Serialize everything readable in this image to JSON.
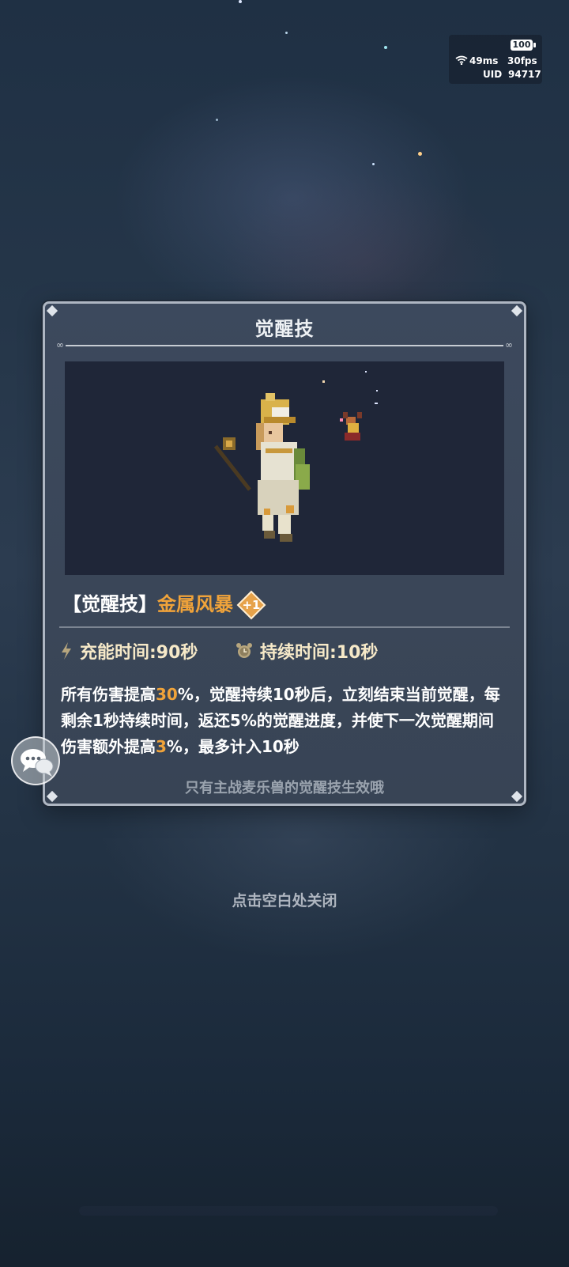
{
  "status": {
    "battery": "100",
    "ping": "49ms",
    "fps": "30fps",
    "uid_label": "UID",
    "uid_value": "94717"
  },
  "dialog": {
    "title": "觉醒技",
    "skill_tag": "【觉醒技】",
    "skill_name": "金属风暴",
    "level_badge": "+1",
    "charge_time": "充能时间:90秒",
    "duration_time": "持续时间:10秒",
    "description": {
      "p1": "所有伤害提高",
      "v1": "30",
      "p2": "%，觉醒持续10秒后，立刻结束当前觉醒，每剩余1秒持续时间，返还5%的觉醒进度，并使下一次觉醒期间伤害额外提高",
      "v2": "3",
      "p3": "%，最多计入10秒"
    },
    "note": "只有主战麦乐兽的觉醒技生效哦"
  },
  "close_hint": "点击空白处关闭",
  "colors": {
    "accent_orange": "#f0a33a",
    "panel_bg": "#3a4658",
    "panel_border": "#aeb6c2"
  },
  "icons": [
    "wifi-icon",
    "lightning-icon",
    "alarm-clock-icon",
    "chat-bubbles-icon"
  ]
}
